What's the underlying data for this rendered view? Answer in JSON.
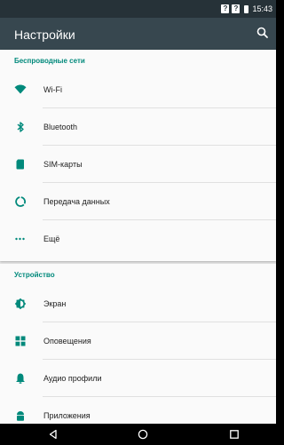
{
  "status_bar": {
    "sim1_glyph": "?",
    "sim2_glyph": "?",
    "time": "15:43"
  },
  "app_bar": {
    "title": "Настройки",
    "search_icon": "search-icon"
  },
  "sections": [
    {
      "header": "Беспроводные сети",
      "items": [
        {
          "label": "Wi-Fi",
          "icon": "wifi-icon"
        },
        {
          "label": "Bluetooth",
          "icon": "bluetooth-icon"
        },
        {
          "label": "SIM-карты",
          "icon": "sim-card-icon"
        },
        {
          "label": "Передача данных",
          "icon": "data-usage-icon"
        },
        {
          "label": "Ещё",
          "icon": "more-icon"
        }
      ]
    },
    {
      "header": "Устройство",
      "items": [
        {
          "label": "Экран",
          "icon": "brightness-icon"
        },
        {
          "label": "Оповещения",
          "icon": "notifications-icon"
        },
        {
          "label": "Аудио профили",
          "icon": "bell-icon"
        },
        {
          "label": "Приложения",
          "icon": "android-icon"
        }
      ]
    }
  ],
  "nav_bar": {
    "back_icon": "back-icon",
    "home_icon": "home-icon",
    "recents_icon": "recents-icon"
  },
  "colors": {
    "status_bar": "#263238",
    "app_bar": "#37474f",
    "accent": "#00897b",
    "background": "#e8e8e8",
    "card": "#fafafa"
  }
}
